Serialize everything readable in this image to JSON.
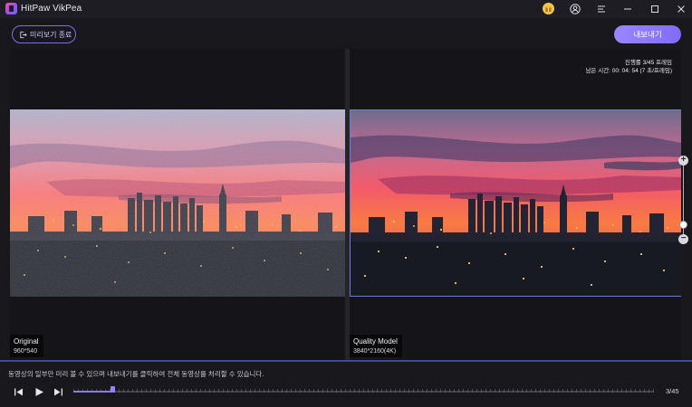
{
  "app": {
    "title": "HitPaw VikPea"
  },
  "toolbar": {
    "exit_preview_label": "미리보기 종료",
    "export_label": "내보내기"
  },
  "preview": {
    "progress_text": "진행률 3/45 프레임",
    "remaining_text": "남은 시간: 00: 04: 54 (7 초/프레임)",
    "original": {
      "label": "Original",
      "resolution": "960*540"
    },
    "enhanced": {
      "label": "Quality Model",
      "resolution": "3840*2160(4K)"
    }
  },
  "notice": "동영상의 일부만 미리 볼 수 있으며 내보내기를 클릭하여 전체 동영상를 처리할 수 있습니다.",
  "player": {
    "current_frame": 3,
    "total_frames": 45,
    "frame_text": "3/45"
  },
  "colors": {
    "accent": "#7f6cf4",
    "panel_bg": "#141419",
    "app_bg": "#17171c"
  },
  "icons": [
    "app-logo-icon",
    "gift-icon",
    "user-icon",
    "menu-icon",
    "minimize-icon",
    "maximize-icon",
    "close-icon",
    "exit-preview-icon",
    "zoom-in-icon",
    "zoom-out-icon",
    "prev-frame-icon",
    "play-icon",
    "next-frame-icon"
  ]
}
